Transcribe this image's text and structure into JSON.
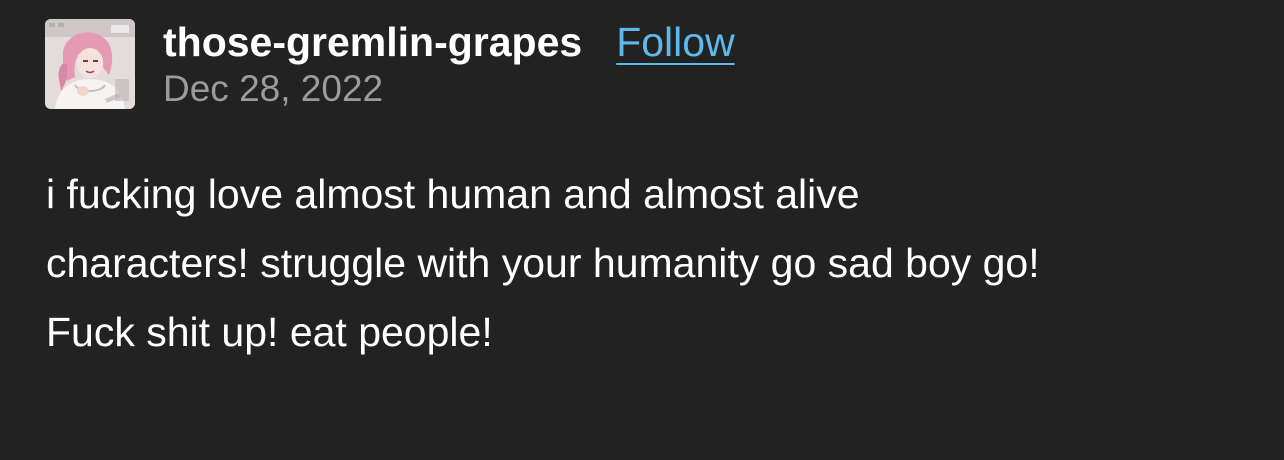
{
  "post": {
    "author": {
      "username": "those-gremlin-grapes",
      "avatar_icon": "avatar-image-pink-haired-character"
    },
    "follow_label": "Follow",
    "date": "Dec 28, 2022",
    "body_lines": [
      "i fucking love almost human and almost alive",
      "characters! struggle with your humanity go sad boy go!",
      "Fuck shit up! eat people!"
    ]
  },
  "colors": {
    "background": "#222222",
    "username": "#ffffff",
    "follow_link": "#5eb9ea",
    "date": "#9b9b9b",
    "body_text": "#ffffff"
  }
}
